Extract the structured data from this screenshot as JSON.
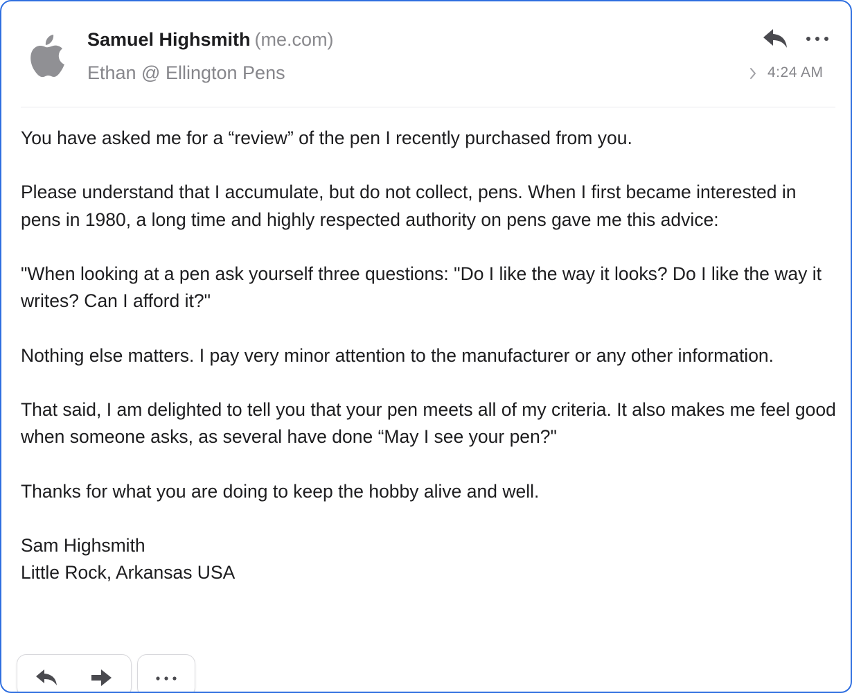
{
  "message": {
    "sender_name": "Samuel Highsmith",
    "sender_domain": "(me.com)",
    "recipient": "Ethan @ Ellington Pens",
    "time": "4:24 AM",
    "avatar_icon": "apple-logo-icon",
    "header_actions": [
      "reply-icon",
      "more-icon"
    ]
  },
  "body": {
    "paragraphs": [
      "You have asked me for a “review” of the pen I recently purchased from you.",
      "Please understand that I accumulate, but do not collect, pens. When I first became interested in pens in 1980, a long time and highly respected authority on pens gave me this advice:",
      "\"When looking at a pen ask yourself three questions:  \"Do I like the way it looks? Do I like the way it writes? Can I afford it?\"",
      "Nothing else matters. I pay very minor attention to the manufacturer or any other information.",
      "That said, I am delighted to tell you that your pen meets all of my criteria. It also makes me feel good when someone asks, as several have done “May I see your pen?\"",
      "Thanks for what you are doing to keep the hobby alive and well."
    ],
    "signature": [
      "Sam Highsmith",
      "Little Rock, Arkansas USA"
    ]
  },
  "footer_toolbar": {
    "icons": [
      "reply-icon",
      "forward-icon",
      "more-icon"
    ]
  },
  "colors": {
    "focus_border": "#2f6fe0",
    "secondary_text": "#86868b",
    "primary_text": "#1d1d1f"
  }
}
